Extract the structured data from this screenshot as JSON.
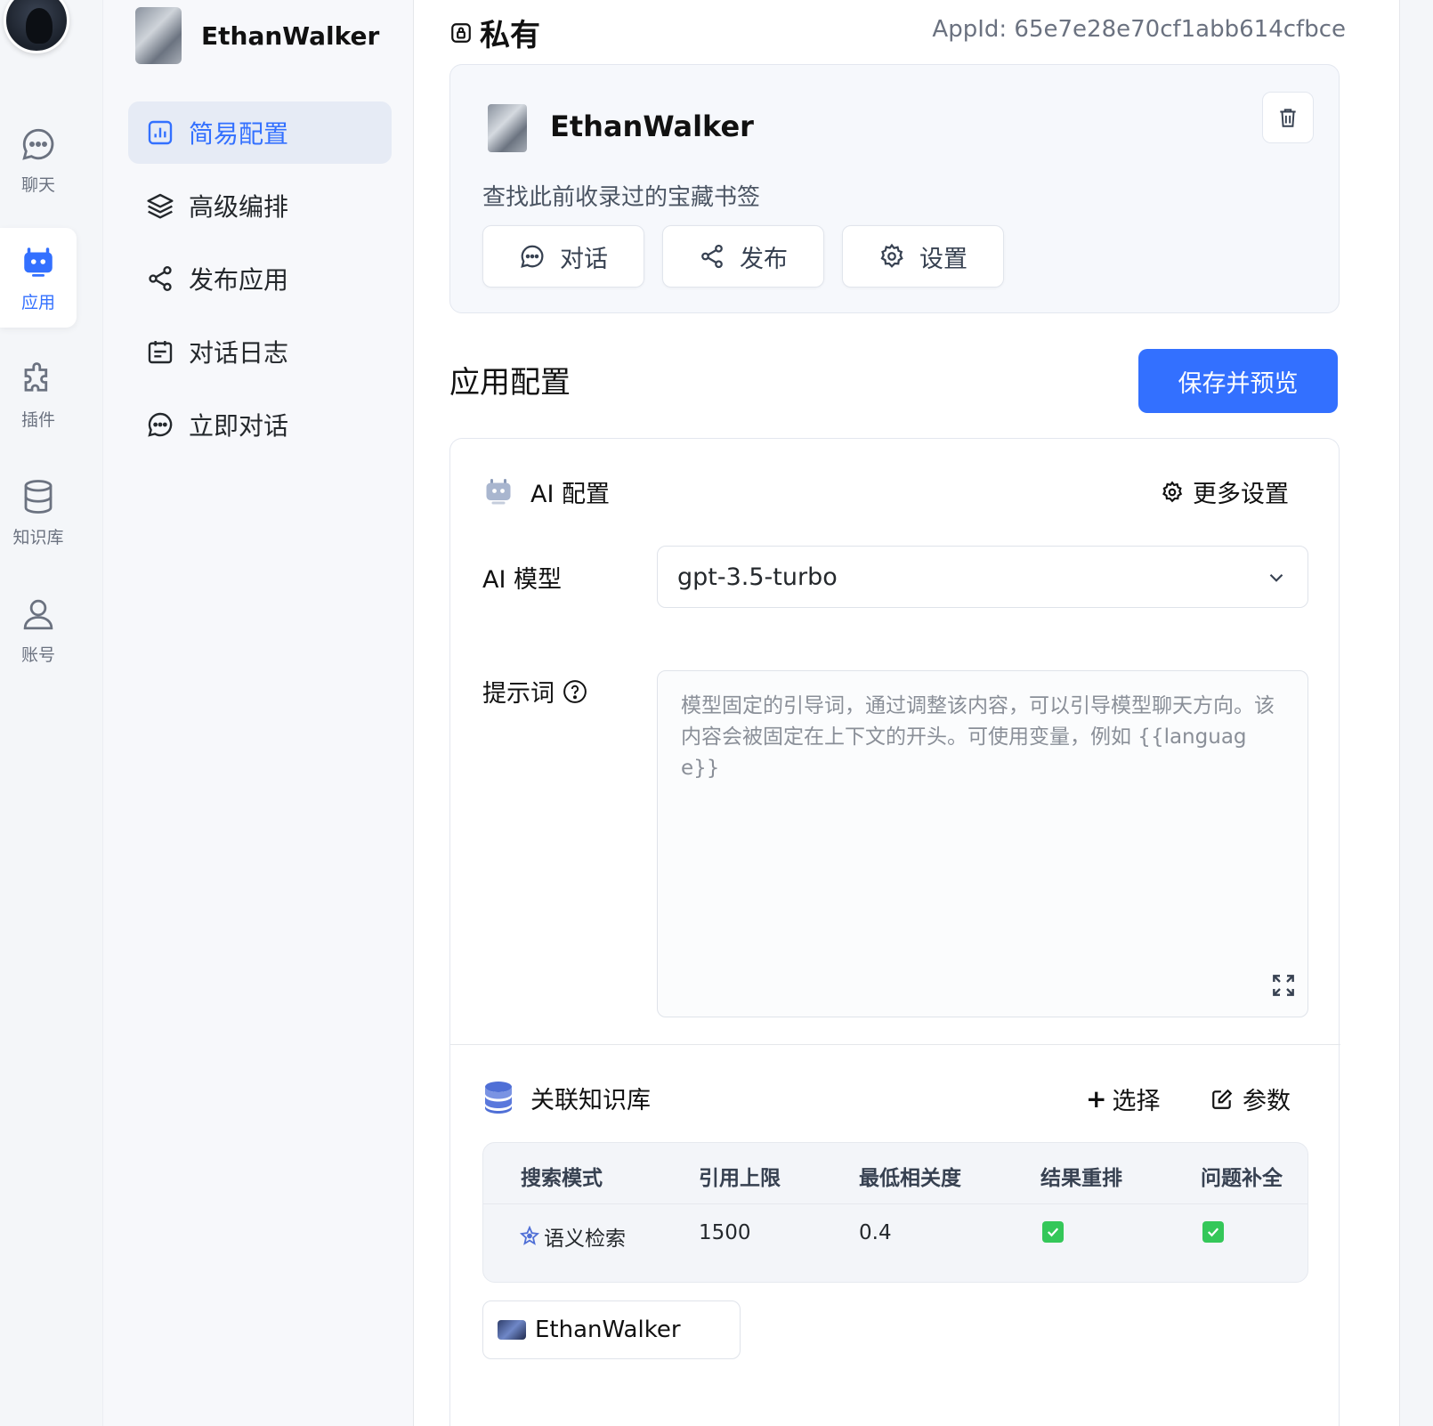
{
  "rail": {
    "items": [
      {
        "label": "聊天",
        "icon": "chat-icon"
      },
      {
        "label": "应用",
        "icon": "robot-icon"
      },
      {
        "label": "插件",
        "icon": "puzzle-icon"
      },
      {
        "label": "知识库",
        "icon": "database-icon"
      },
      {
        "label": "账号",
        "icon": "user-icon"
      }
    ],
    "active_index": 1
  },
  "nav": {
    "app_name": "EthanWalker",
    "items": [
      {
        "label": "简易配置",
        "icon": "chart-box-icon"
      },
      {
        "label": "高级编排",
        "icon": "layers-icon"
      },
      {
        "label": "发布应用",
        "icon": "share-icon"
      },
      {
        "label": "对话日志",
        "icon": "calendar-log-icon"
      },
      {
        "label": "立即对话",
        "icon": "chat-icon"
      }
    ],
    "active_index": 0
  },
  "header": {
    "title": "私有",
    "appid": "AppId: 65e7e28e70cf1abb614cfbce"
  },
  "app_card": {
    "name": "EthanWalker",
    "description": "查找此前收录过的宝藏书签",
    "buttons": [
      {
        "label": "对话",
        "icon": "chat-icon"
      },
      {
        "label": "发布",
        "icon": "share-icon"
      },
      {
        "label": "设置",
        "icon": "gear-icon"
      }
    ]
  },
  "config": {
    "section_title": "应用配置",
    "save_label": "保存并预览",
    "ai_title": "AI 配置",
    "more_settings": "更多设置",
    "model_label": "AI 模型",
    "model_value": "gpt-3.5-turbo",
    "prompt_label": "提示词",
    "prompt_placeholder": "模型固定的引导词，通过调整该内容，可以引导模型聊天方向。该内容会被固定在上下文的开头。可使用变量，例如 {{language}}"
  },
  "knowledge": {
    "title": "关联知识库",
    "select_label": "选择",
    "params_label": "参数",
    "headers": [
      "搜索模式",
      "引用上限",
      "最低相关度",
      "结果重排",
      "问题补全"
    ],
    "row": {
      "mode": "语义检索",
      "limit": "1500",
      "similarity": "0.4",
      "rerank": true,
      "query_extension": true
    },
    "linked": [
      {
        "name": "EthanWalker"
      }
    ]
  },
  "colors": {
    "accent": "#3370ff",
    "check": "#34c759"
  }
}
